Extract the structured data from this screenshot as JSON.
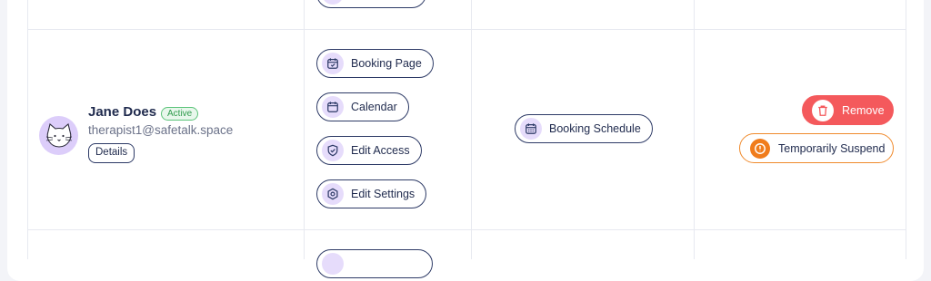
{
  "colors": {
    "accent_purple": "#e6dcfb",
    "outline_navy": "#2d3a66",
    "remove_red": "#f4595c",
    "suspend_orange": "#f07c1c",
    "active_green": "#2e9a4c"
  },
  "user": {
    "name": "Jane Does",
    "status": "Active",
    "email": "therapist1@safetalk.space",
    "details_label": "Details",
    "avatar_icon": "cat-avatar-icon"
  },
  "actions": {
    "booking_page": {
      "label": "Booking Page",
      "icon": "calendar-check-icon"
    },
    "calendar": {
      "label": "Calendar",
      "icon": "calendar-icon"
    },
    "edit_access": {
      "label": "Edit Access",
      "icon": "shield-check-icon"
    },
    "edit_settings": {
      "label": "Edit Settings",
      "icon": "gear-icon"
    }
  },
  "schedule": {
    "label": "Booking Schedule",
    "icon": "calendar-grid-icon"
  },
  "manage": {
    "remove_label": "Remove",
    "remove_icon": "trash-icon",
    "suspend_label": "Temporarily Suspend",
    "suspend_icon": "alert-circle-icon"
  }
}
